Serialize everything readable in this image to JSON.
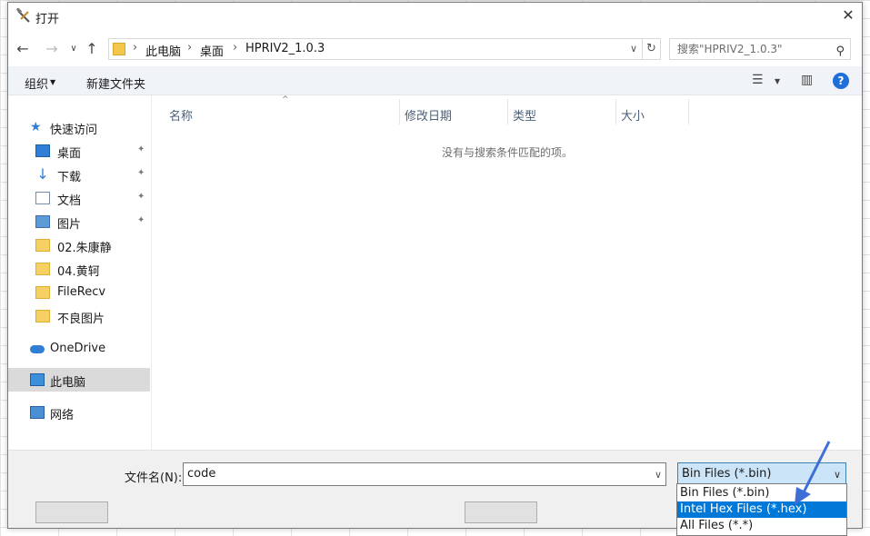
{
  "window": {
    "title": "打开",
    "close_label": "✕"
  },
  "nav": {
    "back": "←",
    "forward": "→",
    "recent": "∨",
    "up": "↑",
    "breadcrumb": [
      "此电脑",
      "桌面",
      "HPRIV2_1.0.3"
    ],
    "separator": "›",
    "dropdown": "∨",
    "refresh": "↻",
    "search_placeholder": "搜索\"HPRIV2_1.0.3\"",
    "search_icon": "⚲"
  },
  "toolbar": {
    "organize_label": "组织",
    "organize_arrow": "▼",
    "new_folder_label": "新建文件夹",
    "view_icon": "☰",
    "view_arrow": "▼",
    "preview_icon": "▥",
    "help_label": "?"
  },
  "sidebar": {
    "quick_access": "快速访问",
    "pin": "✦",
    "items": [
      {
        "label": "桌面",
        "pinned": true
      },
      {
        "label": "下载",
        "pinned": true
      },
      {
        "label": "文档",
        "pinned": true
      },
      {
        "label": "图片",
        "pinned": true
      },
      {
        "label": "02.朱康静",
        "pinned": false
      },
      {
        "label": "04.黄轲",
        "pinned": false
      },
      {
        "label": "FileRecv",
        "pinned": false
      },
      {
        "label": "不良图片",
        "pinned": false
      }
    ],
    "onedrive": "OneDrive",
    "this_pc": "此电脑",
    "network": "网络",
    "download_arrow": "↓",
    "star": "★"
  },
  "filelist": {
    "columns": [
      "名称",
      "修改日期",
      "类型",
      "大小"
    ],
    "sort_arrow": "^",
    "empty_message": "没有与搜索条件匹配的项。"
  },
  "bottom": {
    "filename_label": "文件名(N):",
    "filename_value": "code",
    "dropdown": "∨",
    "filetype_selected": "Bin Files (*.bin)",
    "filetype_options": [
      "Bin Files (*.bin)",
      "Intel Hex Files (*.hex)",
      "All Files (*.*)"
    ],
    "highlighted_index": 1
  },
  "colors": {
    "accent": "#0078d7",
    "arrow": "#3d6fd6"
  }
}
